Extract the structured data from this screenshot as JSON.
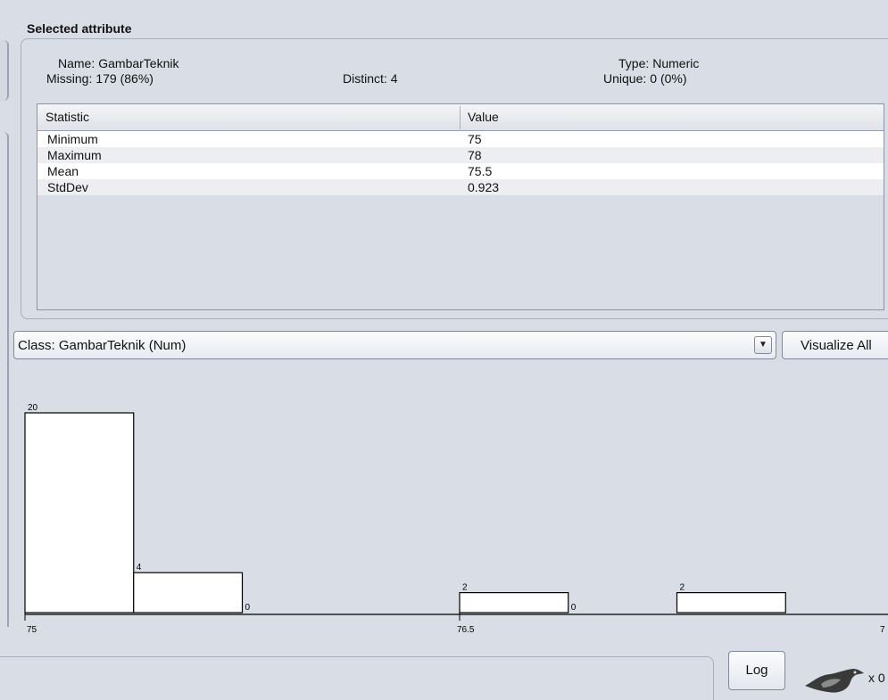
{
  "selected_attribute": {
    "title": "Selected attribute",
    "name_label": "Name:",
    "name_value": "GambarTeknik",
    "missing_label": "Missing:",
    "missing_value": "179 (86%)",
    "distinct_label": "Distinct:",
    "distinct_value": "4",
    "type_label": "Type:",
    "type_value": "Numeric",
    "unique_label": "Unique:",
    "unique_value": "0 (0%)"
  },
  "stats_table": {
    "headers": [
      "Statistic",
      "Value"
    ],
    "rows": [
      {
        "statistic": "Minimum",
        "value": "75"
      },
      {
        "statistic": "Maximum",
        "value": "78"
      },
      {
        "statistic": "Mean",
        "value": "75.5"
      },
      {
        "statistic": "StdDev",
        "value": "0.923"
      }
    ]
  },
  "class_select": {
    "value": "Class: GambarTeknik (Num)",
    "arrow": "▼"
  },
  "visualize_all_label": "Visualize All",
  "chart_data": {
    "type": "bar",
    "bins": [
      {
        "from": 75,
        "to": 75.375,
        "count": 20
      },
      {
        "from": 75.375,
        "to": 75.75,
        "count": 4
      },
      {
        "from": 75.75,
        "to": 76.125,
        "count": 0
      },
      {
        "from": 76.5,
        "to": 76.875,
        "count": 2
      },
      {
        "from": 76.875,
        "to": 77.25,
        "count": 0
      },
      {
        "from": 77.25,
        "to": 77.625,
        "count": 2
      }
    ],
    "x_ticks": [
      "75",
      "76.5",
      "7"
    ],
    "xlim": [
      75,
      78
    ],
    "ylim": [
      0,
      20
    ]
  },
  "status": {
    "log_label": "Log",
    "count_text": "x 0",
    "bird_icon": "weka-bird-icon"
  },
  "colors": {
    "background": "#d9dde6",
    "bar_fill": "#ffffff",
    "bar_stroke": "#000000"
  }
}
